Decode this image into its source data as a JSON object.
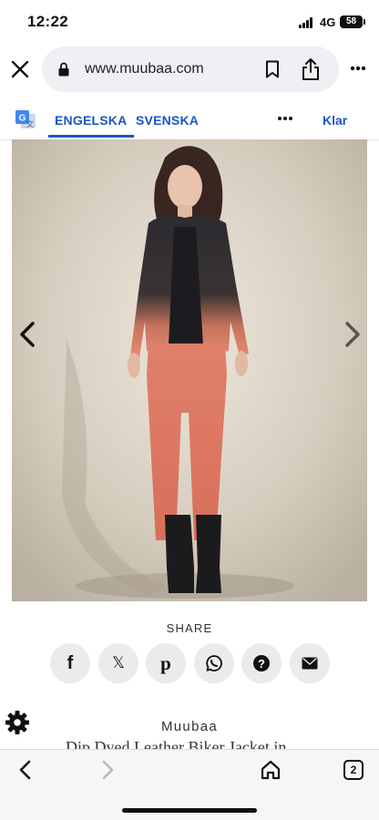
{
  "status_bar": {
    "time": "12:22",
    "network": "4G",
    "battery": "58"
  },
  "browser": {
    "url": "www.muubaa.com",
    "icons": {
      "close": "close-icon",
      "lock": "lock-icon",
      "bookmark": "bookmark-icon",
      "share": "share-icon",
      "more": "more-vertical-icon"
    }
  },
  "translate": {
    "icon": "google-translate-icon",
    "tabs": [
      {
        "label": "ENGELSKA",
        "active": true
      },
      {
        "label": "SVENSKA",
        "active": false
      }
    ],
    "more_icon": "more-horizontal-icon",
    "done_label": "Klar"
  },
  "gallery": {
    "prev_icon": "chevron-left-icon",
    "next_icon": "chevron-right-icon"
  },
  "share": {
    "label": "SHARE",
    "buttons": [
      {
        "icon": "facebook-icon",
        "glyph": "f"
      },
      {
        "icon": "x-icon",
        "glyph": "𝕏"
      },
      {
        "icon": "pinterest-icon",
        "glyph": "p"
      },
      {
        "icon": "whatsapp-icon",
        "glyph": ""
      },
      {
        "icon": "question-icon",
        "glyph": "?"
      },
      {
        "icon": "email-icon",
        "glyph": ""
      }
    ]
  },
  "product": {
    "brand": "Muubaa",
    "title": "Dip Dyed Leather Biker Jacket in"
  },
  "toolbar": {
    "back_icon": "back-arrow-icon",
    "forward_icon": "forward-arrow-icon",
    "home_icon": "home-icon",
    "tab_count": "2"
  },
  "colors": {
    "accent": "#1a57c4",
    "wall": "#d9d1c4",
    "jeans": "#e07a62",
    "jacket": "#2b2a2e"
  }
}
